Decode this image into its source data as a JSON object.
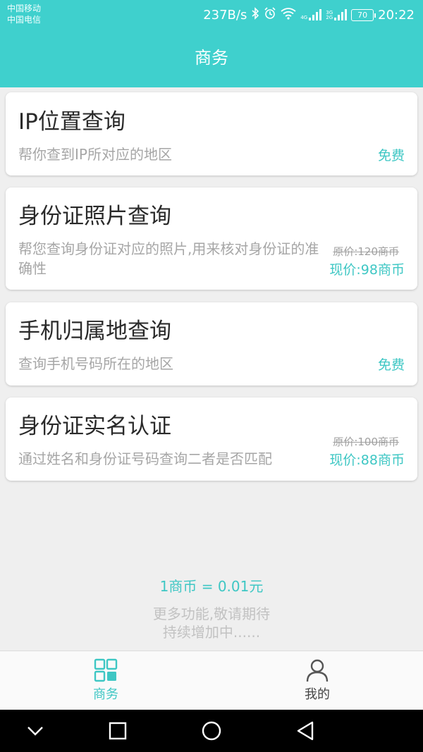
{
  "status_bar": {
    "carrier_1": "中国移动",
    "carrier_2": "中国电信",
    "net_speed": "237B/s",
    "network_4g": "4G",
    "network_3g": "3G",
    "network_2g": "2G",
    "battery": "70",
    "time": "20:22"
  },
  "header": {
    "title": "商务"
  },
  "services": [
    {
      "title": "IP位置查询",
      "desc": "帮你查到IP所对应的地区",
      "price": "免费"
    },
    {
      "title": "身份证照片查询",
      "desc": "帮您查询身份证对应的照片,用来核对身份证的准确性",
      "orig_price": "原价:120商币",
      "price": "现价:98商币"
    },
    {
      "title": "手机归属地查询",
      "desc": "查询手机号码所在的地区",
      "price": "免费"
    },
    {
      "title": "身份证实名认证",
      "desc": "通过姓名和身份证号码查询二者是否匹配",
      "orig_price": "原价:100商币",
      "price": "现价:88商币"
    }
  ],
  "footer": {
    "rate": "1商币 = 0.01元",
    "more_line_1": "更多功能,敬请期待",
    "more_line_2": "持续增加中......"
  },
  "tabs": [
    {
      "label": "商务",
      "icon": "grid-icon",
      "active": true
    },
    {
      "label": "我的",
      "icon": "user-icon",
      "active": false
    }
  ],
  "colors": {
    "accent": "#3fd0cd",
    "accent_text": "#3ec7c4",
    "inactive_tab": "#444444"
  }
}
